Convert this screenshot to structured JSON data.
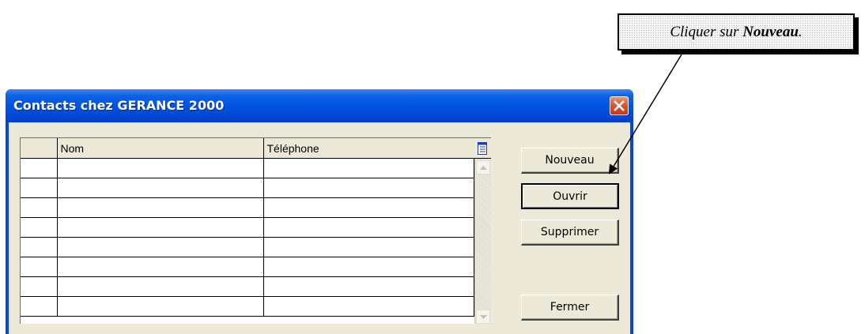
{
  "callout": {
    "prefix": "Cliquer sur ",
    "emphasis": "Nouveau",
    "suffix": "."
  },
  "window": {
    "title": "Contacts chez GERANCE 2000",
    "close_icon": "close-icon",
    "titlebar_color": "#0a46d6",
    "close_color": "#d8542d"
  },
  "grid": {
    "columns": [
      "",
      "Nom",
      "Téléphone"
    ],
    "column_chooser_icon": "column-chooser-icon",
    "rows": [
      [
        "",
        "",
        ""
      ],
      [
        "",
        "",
        ""
      ],
      [
        "",
        "",
        ""
      ],
      [
        "",
        "",
        ""
      ],
      [
        "",
        "",
        ""
      ],
      [
        "",
        "",
        ""
      ],
      [
        "",
        "",
        ""
      ],
      [
        "",
        "",
        ""
      ]
    ]
  },
  "buttons": {
    "new_label": "Nouveau",
    "open_label": "Ouvrir",
    "delete_label": "Supprimer",
    "close_label": "Fermer"
  }
}
